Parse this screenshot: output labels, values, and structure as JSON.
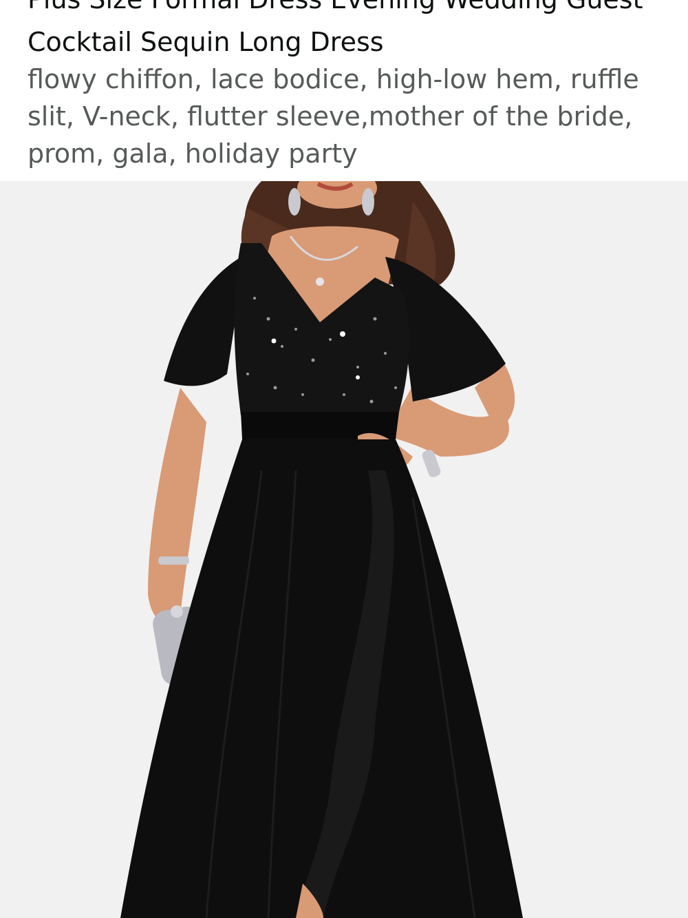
{
  "product": {
    "title_line1": "Plus Size Formal Dress Evening Wedding Guest",
    "title_line2": "Cocktail Sequin Long Dress",
    "description_lines": [
      "flowy chiffon, lace bodice, high-low hem, ruffle",
      "slit, V-neck, flutter sleeve,mother of the bride,",
      "prom, gala, holiday party"
    ]
  },
  "image": {
    "subject": "black-sequin-chiffon-dress-model",
    "colors": {
      "background": "#f1f1f1",
      "dress": "#0e0e0e",
      "skin": "#d99a76",
      "hair": "#4a2a1c",
      "silver": "#c9c9cf"
    }
  }
}
